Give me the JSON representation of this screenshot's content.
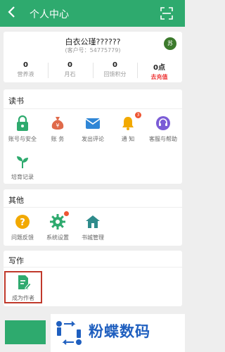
{
  "header": {
    "back_icon": "chevron-left-icon",
    "title": "个人中心",
    "scan_icon": "scan-icon"
  },
  "profile": {
    "username": "白衣公瑾??????",
    "customer_id": "(客户号：54775779)",
    "level_badge": "苏",
    "stats": [
      {
        "value": "0",
        "label": "营养液"
      },
      {
        "value": "0",
        "label": "月石"
      },
      {
        "value": "0",
        "label": "回馈积分"
      },
      {
        "value": "0点",
        "label": "去充值"
      }
    ]
  },
  "reading": {
    "title": "读书",
    "items": [
      {
        "label": "账号与安全",
        "icon": "lock-icon"
      },
      {
        "label": "账 务",
        "icon": "money-bag-icon"
      },
      {
        "label": "发出评论",
        "icon": "envelope-icon"
      },
      {
        "label": "通 知",
        "icon": "bell-icon",
        "badge": "3"
      },
      {
        "label": "客服与帮助",
        "icon": "headset-icon"
      },
      {
        "label": "培育记录",
        "icon": "sprout-icon"
      }
    ]
  },
  "other": {
    "title": "其他",
    "items": [
      {
        "label": "问题反馈",
        "icon": "question-icon"
      },
      {
        "label": "系统设置",
        "icon": "gear-icon"
      },
      {
        "label": "书城管理",
        "icon": "home-icon"
      }
    ]
  },
  "writing": {
    "title": "写作",
    "items": [
      {
        "label": "成为作者",
        "icon": "pen-document-icon"
      }
    ]
  },
  "watermark": {
    "text": "粉蝶数码"
  },
  "colors": {
    "primary": "#2eaa6e",
    "accent_red": "#e33333",
    "highlight_border": "#c0392b",
    "watermark_blue": "#1f5fbf"
  }
}
